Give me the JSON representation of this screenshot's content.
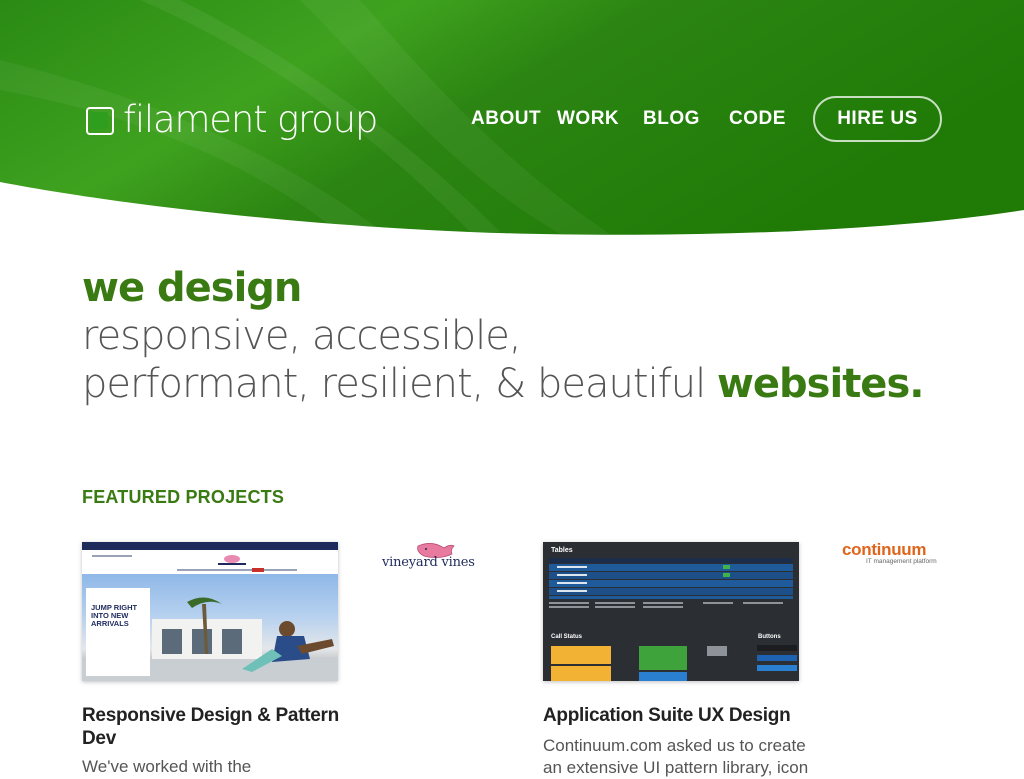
{
  "header": {
    "logo_text": "filament group",
    "nav": [
      {
        "label": "ABOUT"
      },
      {
        "label": "WORK"
      },
      {
        "label": "BLOG"
      },
      {
        "label": "CODE"
      }
    ],
    "hire_label": "HIRE US"
  },
  "hero": {
    "lead": "we design",
    "line2": "responsive, accessible,",
    "line3": "performant, resilient, & beautiful",
    "emphasis": "websites."
  },
  "featured": {
    "title": "FEATURED PROJECTS",
    "projects": [
      {
        "title_line1": "Responsive Design & Pattern",
        "title_line2": "Dev",
        "desc": "We've worked with the",
        "client_logo": "vineyard vines",
        "thumb_headline": "JUMP RIGHT INTO NEW ARRIVALS"
      },
      {
        "title_line1": "Application Suite UX Design",
        "desc_line1": "Continuum.com asked us to create",
        "desc_line2": "an extensive UI pattern library, icon",
        "client_logo": "continuum",
        "client_tagline": "IT management platform",
        "thumb_heading": "Tables",
        "thumb_sub1": "Call Status",
        "thumb_sub2": "Buttons"
      }
    ]
  },
  "colors": {
    "brand_green": "#2a7c0e",
    "text_green": "#3a7a12",
    "text_gray": "#555555"
  }
}
